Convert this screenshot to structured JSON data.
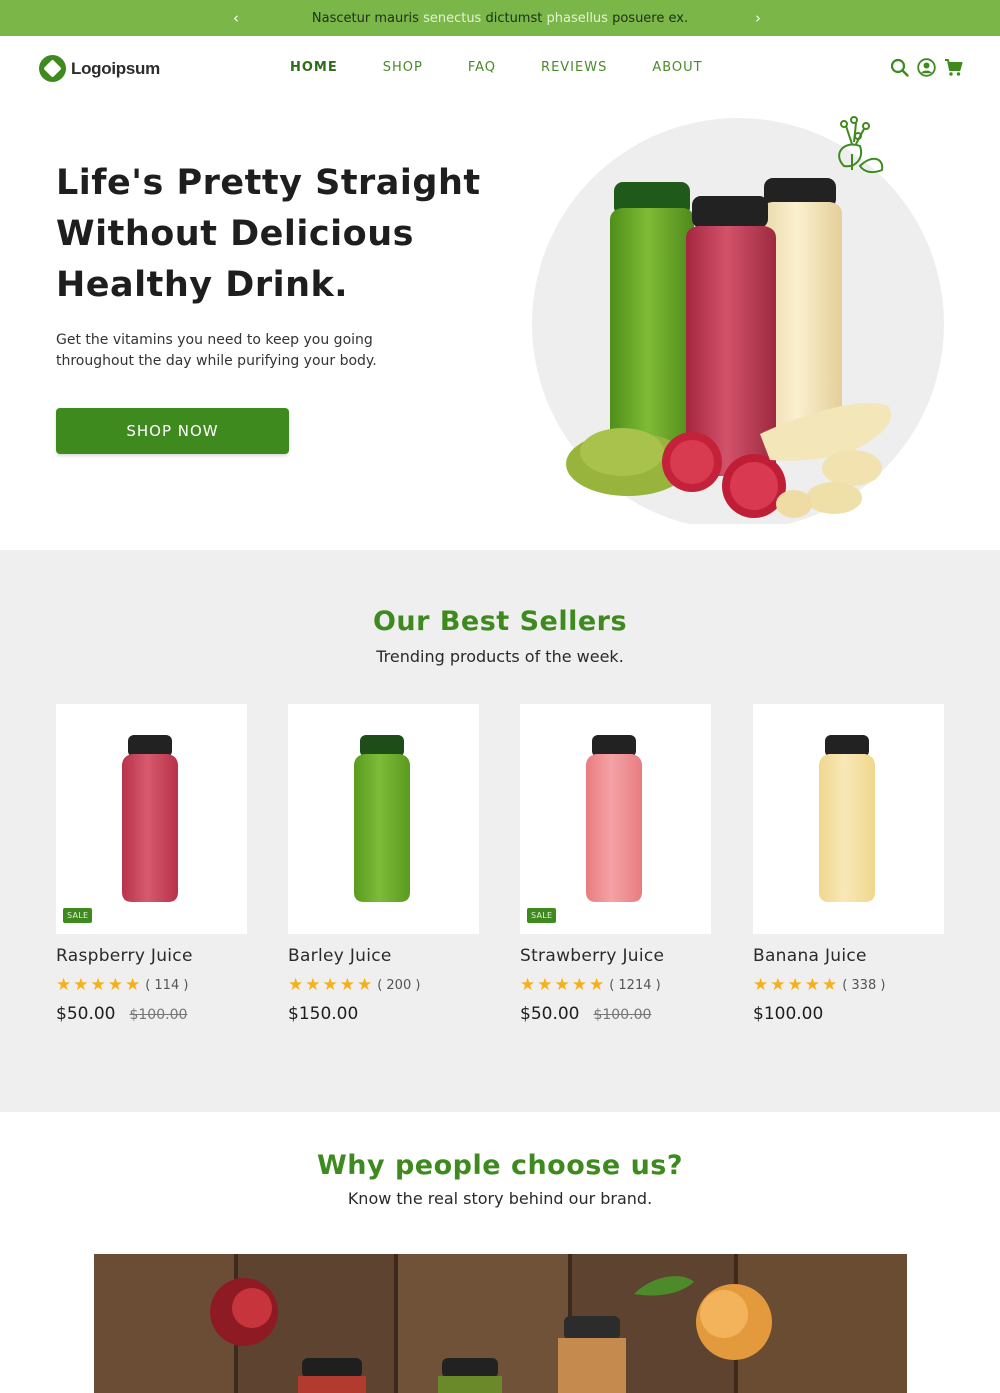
{
  "announcement": {
    "prev_icon": "chevron-left-icon",
    "next_icon": "chevron-right-icon",
    "prev_glyph": "‹",
    "next_glyph": "›",
    "part1": "Nascetur mauris ",
    "part2": "senectus",
    "part3": " dictumst ",
    "part4": "phasellus",
    "part5": " posuere ex."
  },
  "header": {
    "logo_text": "Logoipsum",
    "nav": [
      "HOME",
      "SHOP",
      "FAQ",
      "REVIEWS",
      "ABOUT"
    ],
    "active_nav": "HOME",
    "icons": [
      "search-icon",
      "account-icon",
      "cart-icon"
    ]
  },
  "hero": {
    "title": "Life's Pretty Straight Without Delicious Healthy Drink.",
    "subtitle": "Get the vitamins you need to keep you going throughout the day while purifying your body.",
    "cta": "SHOP NOW"
  },
  "best_sellers": {
    "title": "Our Best Sellers",
    "subtitle": "Trending products of the week.",
    "products": [
      {
        "name": "Raspberry Juice",
        "rating": "★★★★★",
        "stars": 5,
        "reviews": "( 114 )",
        "price": "$50.00",
        "old_price": "$100.00",
        "badge": "SALE",
        "color": "#b8324a",
        "color_light": "#d65a6e",
        "cap": "#222222"
      },
      {
        "name": "Barley Juice",
        "rating": "★★★★★",
        "stars": 5,
        "reviews": "( 200 )",
        "price": "$150.00",
        "old_price": "",
        "badge": "",
        "color": "#5a9a1e",
        "color_light": "#7dbb38",
        "cap": "#1e4d1a"
      },
      {
        "name": "Strawberry Juice",
        "rating": "★★★★★",
        "stars": 5,
        "reviews": "( 1214 )",
        "price": "$50.00",
        "old_price": "$100.00",
        "badge": "SALE",
        "color": "#e87c80",
        "color_light": "#f4a3a6",
        "cap": "#222222"
      },
      {
        "name": "Banana Juice",
        "rating": "★★★★★",
        "stars": 5,
        "reviews": "( 338 )",
        "price": "$100.00",
        "old_price": "",
        "badge": "",
        "color": "#f0d78e",
        "color_light": "#f8e8b8",
        "cap": "#222222"
      }
    ]
  },
  "why": {
    "title": "Why people choose us?",
    "subtitle": "Know the real story behind our brand."
  },
  "colors": {
    "brand_green": "#3f8a1f",
    "announce_bar": "#7ab648",
    "section_bg": "#efefef",
    "star": "#f5b11c"
  }
}
